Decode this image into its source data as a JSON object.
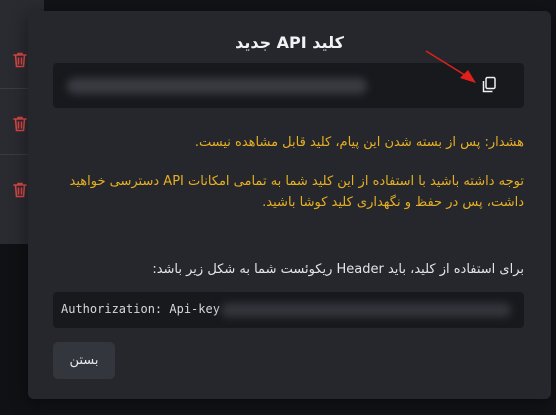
{
  "modal": {
    "title": "کلید API جدید",
    "copy_icon": "copy-icon",
    "warning_1": "هشدار: پس از بسته شدن این پیام، کلید قابل مشاهده نیست.",
    "warning_2": "توجه داشته باشید با استفاده از این کلید شما به تمامی امکانات API دسترسی خواهید داشت، پس در حفظ و نگهداری کلید کوشا باشید.",
    "usage_text": "برای استفاده از کلید، باید Header ریکوئست شما به شکل زیر باشد:",
    "code_prefix": "Authorization: Api-key",
    "close_label": "بستن"
  },
  "background": {
    "row_icon": "trash-icon"
  },
  "colors": {
    "warning": "#e6b021",
    "danger": "#d94545",
    "arrow": "#e0201b"
  }
}
